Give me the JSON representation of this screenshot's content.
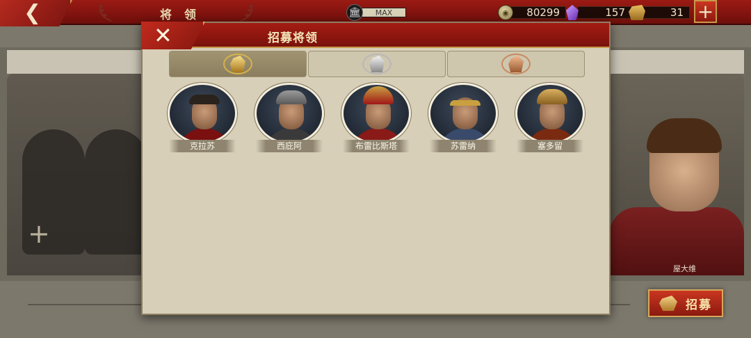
{
  "topbar": {
    "back_icon": "chevron-left-icon",
    "title": "将 领",
    "max_label": "MAX",
    "coins": "80299",
    "gems": "157",
    "helmets": "31",
    "add_icon": "plus-icon"
  },
  "modal": {
    "title": "招募将领",
    "close_icon": "close-icon",
    "tabs": [
      {
        "name": "gold",
        "icon": "gold-helmet-laurel-icon"
      },
      {
        "name": "silver",
        "icon": "silver-helmet-laurel-icon"
      },
      {
        "name": "bronze",
        "icon": "bronze-helmet-laurel-icon"
      }
    ],
    "generals": [
      {
        "name": "克拉苏"
      },
      {
        "name": "西庇阿"
      },
      {
        "name": "布雷比斯塔"
      },
      {
        "name": "苏雷纳"
      },
      {
        "name": "塞多留"
      }
    ]
  },
  "background": {
    "featured_general": "屋大维",
    "recruit_label": "招募"
  },
  "colors": {
    "brand_red": "#9b1a14",
    "gold_trim": "#c79a4a",
    "parchment": "#d7cfb8"
  }
}
